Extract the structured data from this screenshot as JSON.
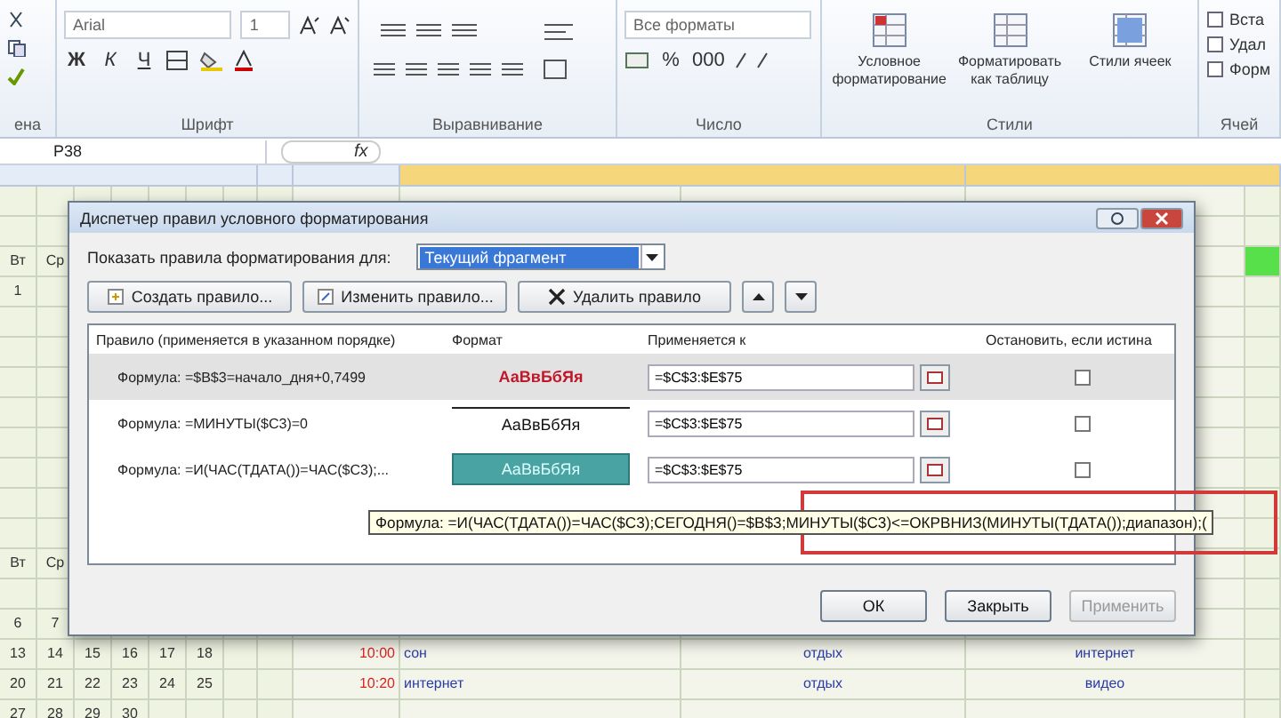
{
  "ribbon": {
    "clipboard_label": "ена",
    "font": {
      "name": "Arial",
      "size": "1",
      "bold": "Ж",
      "italic": "К",
      "underline": "Ч",
      "label": "Шрифт"
    },
    "alignment": {
      "label": "Выравнивание"
    },
    "number": {
      "format": "Все форматы",
      "percent": "%",
      "thousands": "000",
      "label": "Число"
    },
    "styles": {
      "buttons": [
        "Условное форматирование",
        "Форматировать как таблицу",
        "Стили ячеек"
      ],
      "label": "Стили"
    },
    "cells": {
      "buttons": [
        "Вста",
        "Удал",
        "Форм"
      ],
      "label": "Ячей"
    }
  },
  "formula_bar": {
    "name_box": "P38",
    "fx": "fx"
  },
  "sheet": {
    "columns": [
      {
        "selected": false
      },
      {
        "selected": false
      },
      {
        "selected": false
      },
      {
        "selected": true
      },
      {
        "selected": true
      }
    ],
    "rows": [
      {},
      {},
      {
        "calendar": [
          "Вт",
          "Ср"
        ],
        "marked": true
      },
      {
        "calendar": [
          "1"
        ]
      },
      {},
      {},
      {},
      {},
      {},
      {},
      {},
      {},
      {
        "calendar": [
          "Вт",
          "Ср"
        ]
      },
      {},
      {
        "calendar": [
          "6",
          "7"
        ]
      },
      {
        "calendar": [
          "13",
          "14",
          "15",
          "16",
          "17",
          "18"
        ],
        "time": "10:00",
        "activities": [
          "сон",
          "отдых",
          "интернет"
        ]
      },
      {
        "calendar": [
          "20",
          "21",
          "22",
          "23",
          "24",
          "25"
        ],
        "time": "10:20",
        "activities": [
          "интернет",
          "отдых",
          "видео"
        ]
      },
      {
        "calendar": [
          "27",
          "28",
          "29",
          "30"
        ]
      }
    ]
  },
  "dialog": {
    "title": "Диспетчер правил условного форматирования",
    "show_label": "Показать правила форматирования для:",
    "show_value": "Текущий фрагмент",
    "buttons": [
      {
        "label": "Создать правило..."
      },
      {
        "label": "Изменить правило..."
      },
      {
        "label": "Удалить правило"
      }
    ],
    "columns": [
      "Правило (применяется в указанном порядке)",
      "Формат",
      "Применяется к",
      "Остановить, если истина"
    ],
    "rules": [
      {
        "rule": "Формула: =$B$3=начало_дня+0,7499",
        "preview": "АаВвБбЯя",
        "applies_to": "=$C$3:$E$75",
        "stop": false,
        "selected": true
      },
      {
        "rule": "Формула: =МИНУТЫ($C3)=0",
        "preview": "АаВвБбЯя",
        "applies_to": "=$C$3:$E$75",
        "stop": false,
        "selected": false
      },
      {
        "rule": "Формула: =И(ЧАС(ТДАТА())=ЧАС($C3);...",
        "preview": "АаВвБбЯя",
        "applies_to": "=$C$3:$E$75",
        "stop": false,
        "selected": false
      }
    ],
    "tooltip": {
      "text": "Формула: =И(ЧАС(ТДАТА())=ЧАС($C3);СЕГОДНЯ()=$B$3;МИНУТЫ($C3)<=ОКРВНИЗ(МИНУТЫ(ТДАТА());диапазон);(",
      "highlighted": true
    },
    "footer": [
      {
        "label": "ОК",
        "disabled": false
      },
      {
        "label": "Закрыть",
        "disabled": false
      },
      {
        "label": "Применить",
        "disabled": true
      }
    ]
  }
}
